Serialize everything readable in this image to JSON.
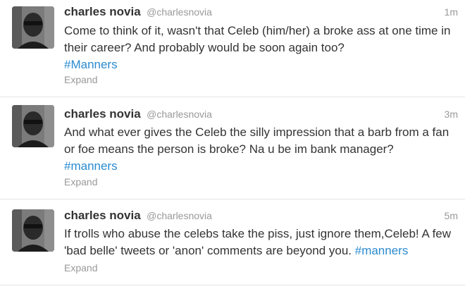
{
  "tweets": [
    {
      "fullname": "charles novia",
      "username": "@charlesnovia",
      "time": "1m",
      "text": "Come to think of it, wasn't that Celeb (him/her) a broke ass at one time in their career? And probably would be soon again too?",
      "hashtag": "#Manners",
      "expand": "Expand",
      "avatar_icon": "user-avatar"
    },
    {
      "fullname": "charles novia",
      "username": "@charlesnovia",
      "time": "3m",
      "text": "And what ever gives the Celeb the silly impression that a barb from a fan or foe means the person is broke? Na u be im bank manager?",
      "hashtag": "#manners",
      "expand": "Expand",
      "avatar_icon": "user-avatar"
    },
    {
      "fullname": "charles novia",
      "username": "@charlesnovia",
      "time": "5m",
      "text": "If trolls who abuse the celebs take the piss, just ignore them,Celeb! A few 'bad belle' tweets or 'anon' comments are beyond you.",
      "hashtag": "#manners",
      "expand": "Expand",
      "avatar_icon": "user-avatar"
    }
  ],
  "colors": {
    "hashtag": "#2a8bd0",
    "name": "#333333",
    "meta": "#999999",
    "divider": "#e3e3e3"
  }
}
